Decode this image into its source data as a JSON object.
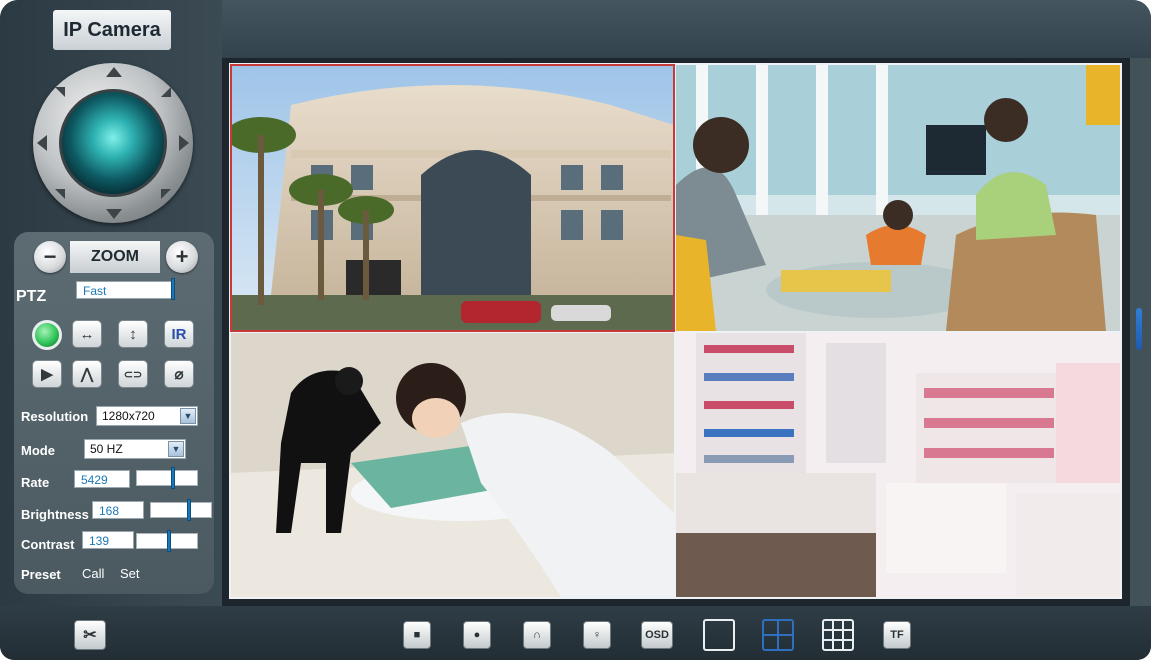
{
  "app": {
    "title": "IP Camera"
  },
  "zoom": {
    "label": "ZOOM",
    "minus": "−",
    "plus": "+"
  },
  "ptz": {
    "label": "PTZ",
    "speed_value": "Fast"
  },
  "buttons": {
    "ir": "IR",
    "flip_h": "↔",
    "flip_v": "↕",
    "play": "▶",
    "mirror": "⋀",
    "cruise_h": "⊂⊃",
    "cruise_v": "⌀"
  },
  "settings": {
    "resolution_label": "Resolution",
    "resolution_value": "1280x720",
    "mode_label": "Mode",
    "mode_value": "50 HZ",
    "rate_label": "Rate",
    "rate_value": "5429",
    "brightness_label": "Brightness",
    "brightness_value": "168",
    "contrast_label": "Contrast",
    "contrast_value": "139",
    "preset_label": "Preset",
    "call_label": "Call",
    "set_label": "Set"
  },
  "toolbar": {
    "record_label": "■",
    "snapshot_label": "●",
    "audio_label": "∩",
    "talk_label": "♀",
    "osd_label": "OSD",
    "tf_label": "TF"
  },
  "colors": {
    "accent": "#1b78b8",
    "selected_border": "#c83a3a",
    "status_green": "#2fc558"
  }
}
